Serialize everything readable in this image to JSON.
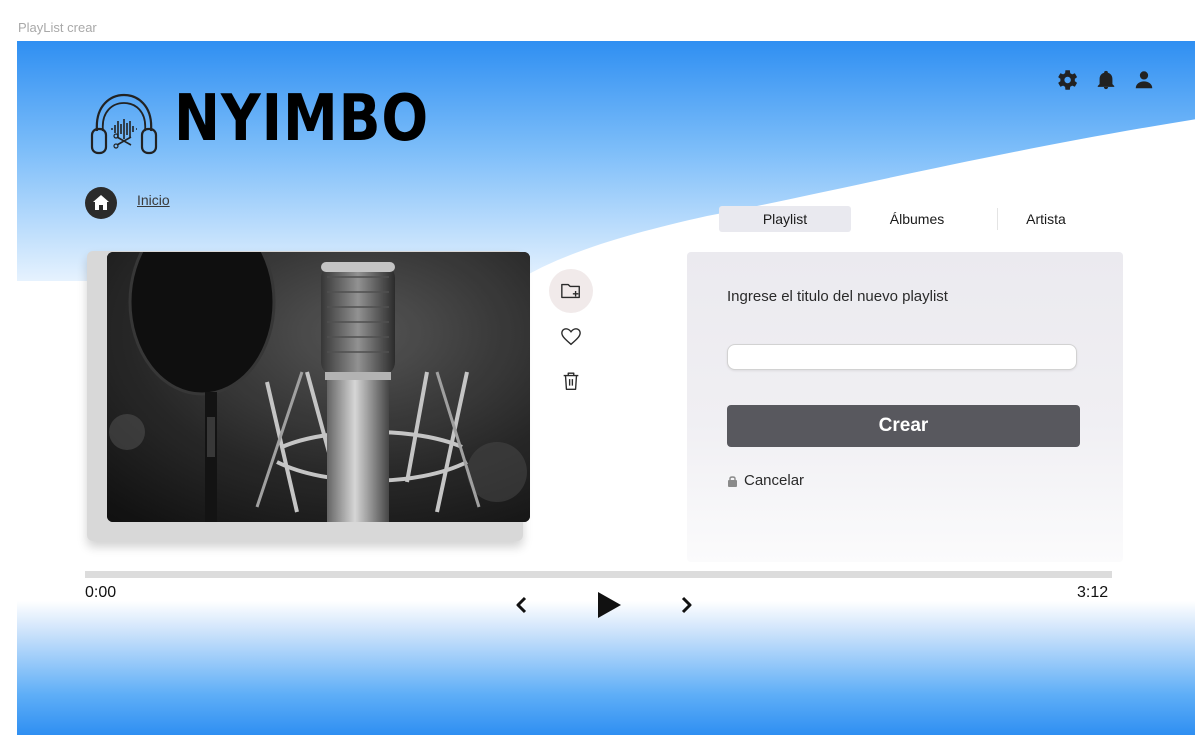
{
  "window": {
    "title": "PlayList crear"
  },
  "header": {
    "brand": "NYIMBO",
    "icons": [
      "gear-icon",
      "bell-icon",
      "user-icon"
    ]
  },
  "breadcrumb": {
    "home_icon": "home-icon",
    "link": "Inicio"
  },
  "tabs": [
    {
      "label": "Playlist",
      "active": true
    },
    {
      "label": "Álbumes",
      "active": false
    },
    {
      "label": "Artista",
      "active": false
    }
  ],
  "media": {
    "image_icon": "microphone-photo",
    "actions": [
      "folder-add-icon",
      "heart-icon",
      "trash-icon"
    ]
  },
  "form": {
    "prompt": "Ingrese el titulo del nuevo playlist",
    "input_value": "",
    "submit_label": "Crear",
    "cancel_label": "Cancelar",
    "cancel_icon": "lock-icon"
  },
  "player": {
    "current_time": "0:00",
    "total_time": "3:12",
    "progress": 0,
    "controls": [
      "prev-icon",
      "play-icon",
      "next-icon"
    ]
  },
  "colors": {
    "accent_blue": "#2f8ff2",
    "button_dark": "#58585e",
    "tab_active_bg": "#e9e9ef"
  }
}
